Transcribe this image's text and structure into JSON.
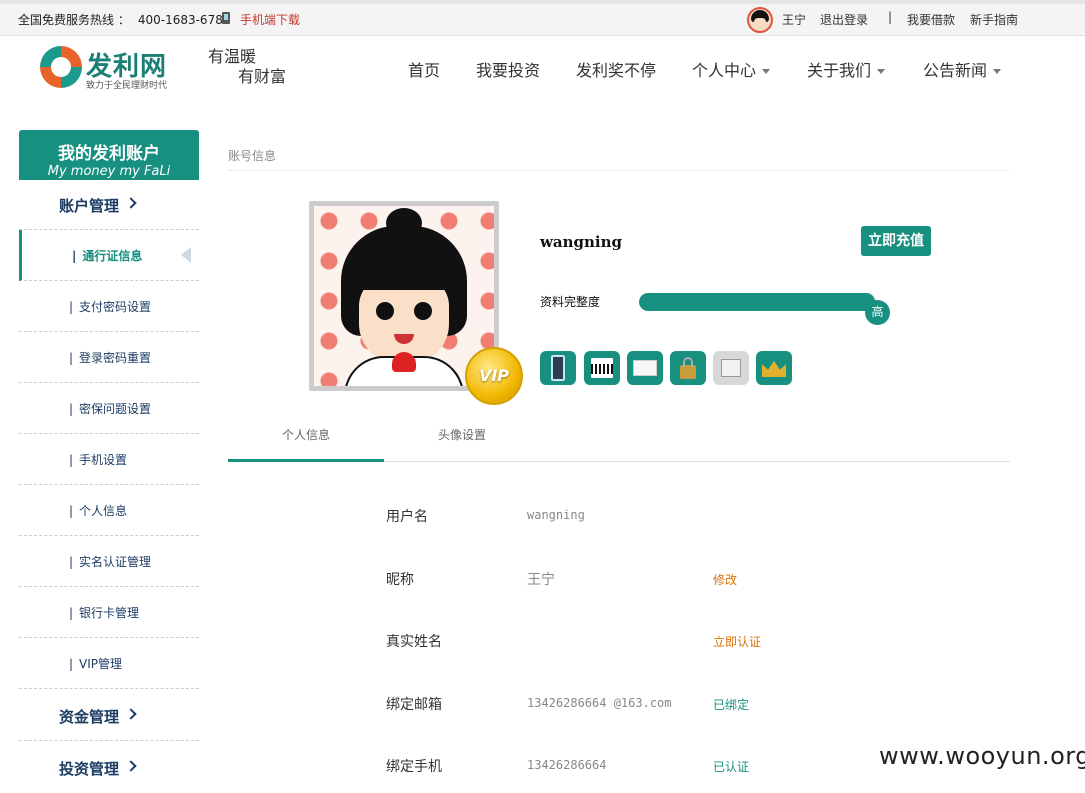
{
  "topbar": {
    "hotline_label": "全国免费服务热线 ：",
    "hotline_number": "400-1683-678",
    "download": "手机端下载",
    "username": "王宁",
    "logout": "退出登录",
    "separator": "|",
    "borrow": "我要借款",
    "guide": "新手指南"
  },
  "logo": {
    "brand": "发利网",
    "tagline": "致力于全民理财时代"
  },
  "motto": {
    "line1": "有温暖",
    "line2": "有财富"
  },
  "nav": {
    "items": [
      {
        "label": "首页",
        "dropdown": false
      },
      {
        "label": "我要投资",
        "dropdown": false
      },
      {
        "label": "发利奖不停",
        "dropdown": false
      },
      {
        "label": "个人中心",
        "dropdown": true
      },
      {
        "label": "关于我们",
        "dropdown": true
      },
      {
        "label": "公告新闻",
        "dropdown": true
      }
    ]
  },
  "sidebar": {
    "banner_cn": "我的发利账户",
    "banner_en": "My money my FaLi",
    "groups": [
      {
        "label": "账户管理"
      },
      {
        "label": "资金管理"
      },
      {
        "label": "投资管理"
      }
    ],
    "items": [
      {
        "label": "通行证信息",
        "active": true
      },
      {
        "label": "支付密码设置",
        "active": false
      },
      {
        "label": "登录密码重置",
        "active": false
      },
      {
        "label": "密保问题设置",
        "active": false
      },
      {
        "label": "手机设置",
        "active": false
      },
      {
        "label": "个人信息",
        "active": false
      },
      {
        "label": "实名认证管理",
        "active": false
      },
      {
        "label": "银行卡管理",
        "active": false
      },
      {
        "label": "VIP管理",
        "active": false
      }
    ]
  },
  "content": {
    "breadcrumb": "账号信息",
    "profile": {
      "username": "wangning",
      "recharge_button": "立即充值",
      "completeness_label": "资料完整度",
      "completeness_value": 0.99,
      "completeness_level": "高",
      "vip_badge": "VIP",
      "badges": [
        {
          "icon": "phone-badge-icon",
          "active": true
        },
        {
          "icon": "id-card-badge-icon",
          "active": true
        },
        {
          "icon": "email-badge-icon",
          "active": true
        },
        {
          "icon": "lock-badge-icon",
          "active": true
        },
        {
          "icon": "bank-badge-icon",
          "active": false
        },
        {
          "icon": "crown-badge-icon",
          "active": true
        }
      ]
    },
    "tabs": [
      {
        "label": "个人信息",
        "active": true
      },
      {
        "label": "头像设置",
        "active": false
      }
    ],
    "fields": [
      {
        "key": "用户名",
        "value": "wangning",
        "action": "",
        "action_color": ""
      },
      {
        "key": "昵称",
        "value": "王宁",
        "action": "修改",
        "action_color": "orange"
      },
      {
        "key": "真实姓名",
        "value": "",
        "action": "立即认证",
        "action_color": "orange"
      },
      {
        "key": "绑定邮箱",
        "value": "13426286664 @163.com",
        "action": "已绑定",
        "action_color": "teal"
      },
      {
        "key": "绑定手机",
        "value": "13426286664",
        "action": "已认证",
        "action_color": "teal"
      }
    ]
  },
  "watermark": "www.wooyun.org",
  "colors": {
    "accent": "#17907f",
    "nav_text": "#1d3c63",
    "action_orange": "#d9730a"
  }
}
